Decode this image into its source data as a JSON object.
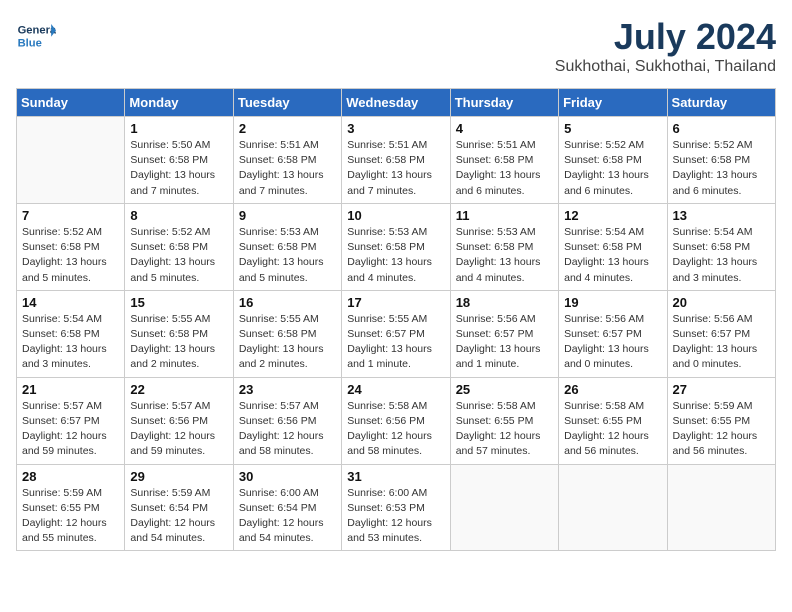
{
  "header": {
    "logo_line1": "General",
    "logo_line2": "Blue",
    "title": "July 2024",
    "subtitle": "Sukhothai, Sukhothai, Thailand"
  },
  "days_of_week": [
    "Sunday",
    "Monday",
    "Tuesday",
    "Wednesday",
    "Thursday",
    "Friday",
    "Saturday"
  ],
  "weeks": [
    [
      {
        "day": "",
        "info": ""
      },
      {
        "day": "1",
        "info": "Sunrise: 5:50 AM\nSunset: 6:58 PM\nDaylight: 13 hours\nand 7 minutes."
      },
      {
        "day": "2",
        "info": "Sunrise: 5:51 AM\nSunset: 6:58 PM\nDaylight: 13 hours\nand 7 minutes."
      },
      {
        "day": "3",
        "info": "Sunrise: 5:51 AM\nSunset: 6:58 PM\nDaylight: 13 hours\nand 7 minutes."
      },
      {
        "day": "4",
        "info": "Sunrise: 5:51 AM\nSunset: 6:58 PM\nDaylight: 13 hours\nand 6 minutes."
      },
      {
        "day": "5",
        "info": "Sunrise: 5:52 AM\nSunset: 6:58 PM\nDaylight: 13 hours\nand 6 minutes."
      },
      {
        "day": "6",
        "info": "Sunrise: 5:52 AM\nSunset: 6:58 PM\nDaylight: 13 hours\nand 6 minutes."
      }
    ],
    [
      {
        "day": "7",
        "info": "Sunrise: 5:52 AM\nSunset: 6:58 PM\nDaylight: 13 hours\nand 5 minutes."
      },
      {
        "day": "8",
        "info": "Sunrise: 5:52 AM\nSunset: 6:58 PM\nDaylight: 13 hours\nand 5 minutes."
      },
      {
        "day": "9",
        "info": "Sunrise: 5:53 AM\nSunset: 6:58 PM\nDaylight: 13 hours\nand 5 minutes."
      },
      {
        "day": "10",
        "info": "Sunrise: 5:53 AM\nSunset: 6:58 PM\nDaylight: 13 hours\nand 4 minutes."
      },
      {
        "day": "11",
        "info": "Sunrise: 5:53 AM\nSunset: 6:58 PM\nDaylight: 13 hours\nand 4 minutes."
      },
      {
        "day": "12",
        "info": "Sunrise: 5:54 AM\nSunset: 6:58 PM\nDaylight: 13 hours\nand 4 minutes."
      },
      {
        "day": "13",
        "info": "Sunrise: 5:54 AM\nSunset: 6:58 PM\nDaylight: 13 hours\nand 3 minutes."
      }
    ],
    [
      {
        "day": "14",
        "info": "Sunrise: 5:54 AM\nSunset: 6:58 PM\nDaylight: 13 hours\nand 3 minutes."
      },
      {
        "day": "15",
        "info": "Sunrise: 5:55 AM\nSunset: 6:58 PM\nDaylight: 13 hours\nand 2 minutes."
      },
      {
        "day": "16",
        "info": "Sunrise: 5:55 AM\nSunset: 6:58 PM\nDaylight: 13 hours\nand 2 minutes."
      },
      {
        "day": "17",
        "info": "Sunrise: 5:55 AM\nSunset: 6:57 PM\nDaylight: 13 hours\nand 1 minute."
      },
      {
        "day": "18",
        "info": "Sunrise: 5:56 AM\nSunset: 6:57 PM\nDaylight: 13 hours\nand 1 minute."
      },
      {
        "day": "19",
        "info": "Sunrise: 5:56 AM\nSunset: 6:57 PM\nDaylight: 13 hours\nand 0 minutes."
      },
      {
        "day": "20",
        "info": "Sunrise: 5:56 AM\nSunset: 6:57 PM\nDaylight: 13 hours\nand 0 minutes."
      }
    ],
    [
      {
        "day": "21",
        "info": "Sunrise: 5:57 AM\nSunset: 6:57 PM\nDaylight: 12 hours\nand 59 minutes."
      },
      {
        "day": "22",
        "info": "Sunrise: 5:57 AM\nSunset: 6:56 PM\nDaylight: 12 hours\nand 59 minutes."
      },
      {
        "day": "23",
        "info": "Sunrise: 5:57 AM\nSunset: 6:56 PM\nDaylight: 12 hours\nand 58 minutes."
      },
      {
        "day": "24",
        "info": "Sunrise: 5:58 AM\nSunset: 6:56 PM\nDaylight: 12 hours\nand 58 minutes."
      },
      {
        "day": "25",
        "info": "Sunrise: 5:58 AM\nSunset: 6:55 PM\nDaylight: 12 hours\nand 57 minutes."
      },
      {
        "day": "26",
        "info": "Sunrise: 5:58 AM\nSunset: 6:55 PM\nDaylight: 12 hours\nand 56 minutes."
      },
      {
        "day": "27",
        "info": "Sunrise: 5:59 AM\nSunset: 6:55 PM\nDaylight: 12 hours\nand 56 minutes."
      }
    ],
    [
      {
        "day": "28",
        "info": "Sunrise: 5:59 AM\nSunset: 6:55 PM\nDaylight: 12 hours\nand 55 minutes."
      },
      {
        "day": "29",
        "info": "Sunrise: 5:59 AM\nSunset: 6:54 PM\nDaylight: 12 hours\nand 54 minutes."
      },
      {
        "day": "30",
        "info": "Sunrise: 6:00 AM\nSunset: 6:54 PM\nDaylight: 12 hours\nand 54 minutes."
      },
      {
        "day": "31",
        "info": "Sunrise: 6:00 AM\nSunset: 6:53 PM\nDaylight: 12 hours\nand 53 minutes."
      },
      {
        "day": "",
        "info": ""
      },
      {
        "day": "",
        "info": ""
      },
      {
        "day": "",
        "info": ""
      }
    ]
  ]
}
